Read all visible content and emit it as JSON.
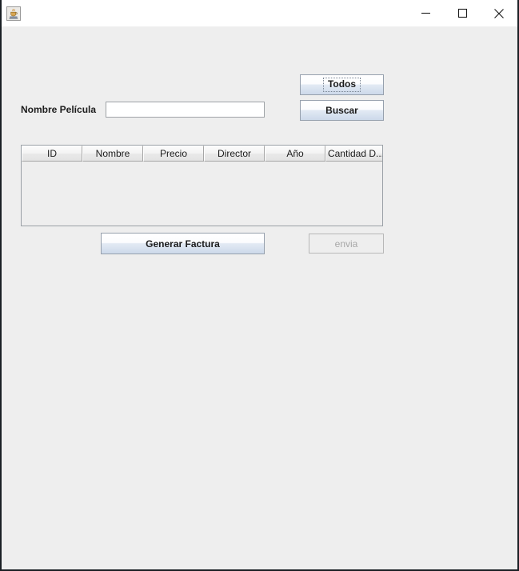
{
  "window": {
    "title": "",
    "icon": "java-coffee-cup-icon",
    "controls": {
      "minimize": "minimize-icon",
      "maximize": "maximize-icon",
      "close": "close-icon"
    }
  },
  "form": {
    "label_nombre_pelicula": "Nombre Película",
    "input_nombre_pelicula": {
      "value": "",
      "placeholder": ""
    }
  },
  "buttons": {
    "todos": "Todos",
    "buscar": "Buscar",
    "generar_factura": "Generar Factura",
    "envia": "envia"
  },
  "table": {
    "columns": [
      {
        "label": "ID",
        "width": 76
      },
      {
        "label": "Nombre",
        "width": 76
      },
      {
        "label": "Precio",
        "width": 76
      },
      {
        "label": "Director",
        "width": 76
      },
      {
        "label": "Año",
        "width": 76
      },
      {
        "label": "Cantidad D...",
        "width": 76
      }
    ],
    "rows": []
  },
  "colors": {
    "window_background": "#eeeeee",
    "titlebar_background": "#ffffff",
    "button_border": "#96a0ad",
    "field_background": "#ffffff",
    "disabled_text": "#a7a7a7"
  }
}
